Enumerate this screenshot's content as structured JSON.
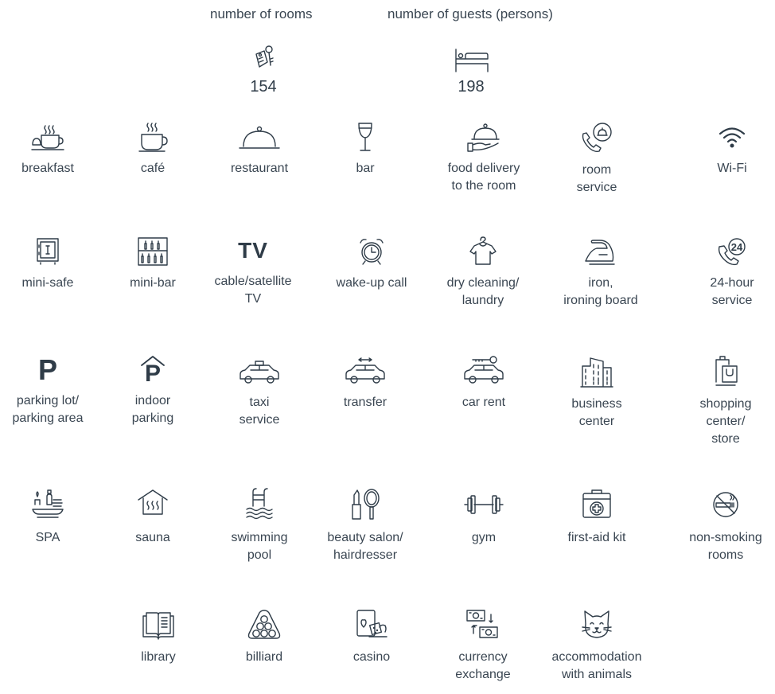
{
  "stats": {
    "rooms": {
      "label": "number of rooms",
      "value": "154",
      "icon": "keys-icon"
    },
    "guests": {
      "label": "number of guests (persons)",
      "value": "198",
      "icon": "bed-icon"
    }
  },
  "amenities": [
    {
      "label": "breakfast",
      "icon": "breakfast-icon"
    },
    {
      "label": "café",
      "icon": "coffee-cup-icon"
    },
    {
      "label": "restaurant",
      "icon": "cloche-icon"
    },
    {
      "label": "bar",
      "icon": "wine-glass-icon"
    },
    {
      "label": "food delivery\nto the room",
      "icon": "serving-hand-icon"
    },
    {
      "label": "room\nservice",
      "icon": "phone-bell-icon"
    },
    {
      "label": "Wi-Fi",
      "icon": "wifi-icon"
    },
    {
      "label": "mini-safe",
      "icon": "safe-icon"
    },
    {
      "label": "mini-bar",
      "icon": "minibar-icon"
    },
    {
      "label": "cable/satellite\nTV",
      "icon": "tv-icon",
      "text": "TV"
    },
    {
      "label": "wake-up call",
      "icon": "alarm-clock-icon"
    },
    {
      "label": "dry cleaning/\nlaundry",
      "icon": "shirt-hanger-icon"
    },
    {
      "label": "iron,\nironing board",
      "icon": "iron-icon"
    },
    {
      "label": "24-hour\nservice",
      "icon": "phone-24-icon"
    },
    {
      "label": "parking lot/\nparking area",
      "icon": "parking-icon",
      "text": "P"
    },
    {
      "label": "indoor\nparking",
      "icon": "indoor-parking-icon",
      "text": "P"
    },
    {
      "label": "taxi\nservice",
      "icon": "taxi-icon"
    },
    {
      "label": "transfer",
      "icon": "transfer-car-icon"
    },
    {
      "label": "car rent",
      "icon": "car-key-icon"
    },
    {
      "label": "business\ncenter",
      "icon": "building-icon"
    },
    {
      "label": "shopping\ncenter/\nstore",
      "icon": "shopping-bag-icon"
    },
    {
      "label": "SPA",
      "icon": "spa-icon"
    },
    {
      "label": "sauna",
      "icon": "sauna-icon"
    },
    {
      "label": "swimming\npool",
      "icon": "pool-icon"
    },
    {
      "label": "beauty salon/\nhairdresser",
      "icon": "beauty-icon"
    },
    {
      "label": "gym",
      "icon": "dumbbell-icon"
    },
    {
      "label": "first-aid kit",
      "icon": "first-aid-icon"
    },
    {
      "label": "non-smoking\nrooms",
      "icon": "no-smoking-icon"
    },
    {
      "label": "library",
      "icon": "book-icon"
    },
    {
      "label": "billiard",
      "icon": "billiard-icon"
    },
    {
      "label": "casino",
      "icon": "casino-icon"
    },
    {
      "label": "currency\nexchange",
      "icon": "currency-exchange-icon"
    },
    {
      "label": "accommodation\nwith animals",
      "icon": "cat-icon"
    }
  ]
}
